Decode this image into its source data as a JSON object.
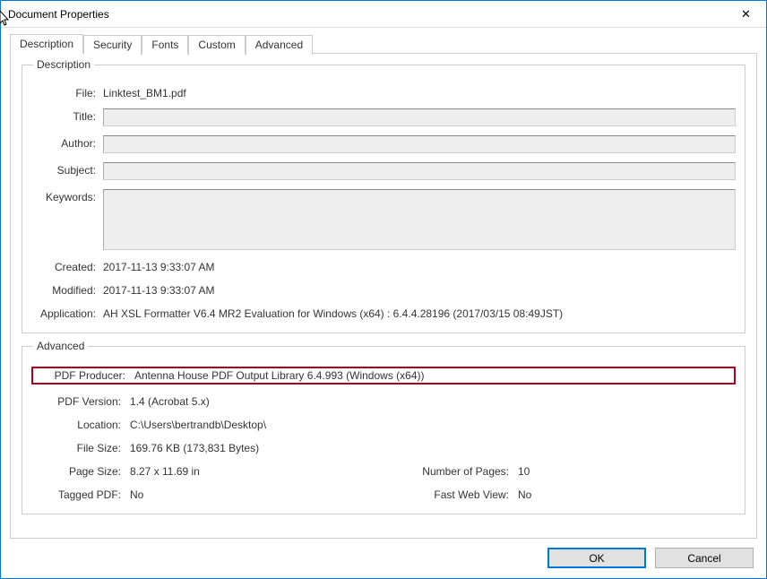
{
  "window": {
    "title": "Document Properties"
  },
  "tabs": [
    "Description",
    "Security",
    "Fonts",
    "Custom",
    "Advanced"
  ],
  "description": {
    "group_label": "Description",
    "labels": {
      "file": "File:",
      "title": "Title:",
      "author": "Author:",
      "subject": "Subject:",
      "keywords": "Keywords:",
      "created": "Created:",
      "modified": "Modified:",
      "application": "Application:"
    },
    "file": "Linktest_BM1.pdf",
    "title": "",
    "author": "",
    "subject": "",
    "keywords": "",
    "created": "2017-11-13 9:33:07 AM",
    "modified": "2017-11-13 9:33:07 AM",
    "application": "AH XSL Formatter V6.4 MR2 Evaluation for Windows (x64) : 6.4.4.28196 (2017/03/15 08:49JST)"
  },
  "advanced": {
    "group_label": "Advanced",
    "labels": {
      "producer": "PDF Producer:",
      "version": "PDF Version:",
      "location": "Location:",
      "file_size": "File Size:",
      "page_size": "Page Size:",
      "pages": "Number of Pages:",
      "tagged": "Tagged PDF:",
      "fast_web": "Fast Web View:"
    },
    "producer": "Antenna House PDF Output Library 6.4.993 (Windows (x64))",
    "version": "1.4 (Acrobat 5.x)",
    "location": "C:\\Users\\bertrandb\\Desktop\\",
    "file_size": "169.76 KB (173,831 Bytes)",
    "page_size": "8.27 x 11.69 in",
    "pages": "10",
    "tagged": "No",
    "fast_web": "No"
  },
  "buttons": {
    "ok": "OK",
    "cancel": "Cancel"
  }
}
